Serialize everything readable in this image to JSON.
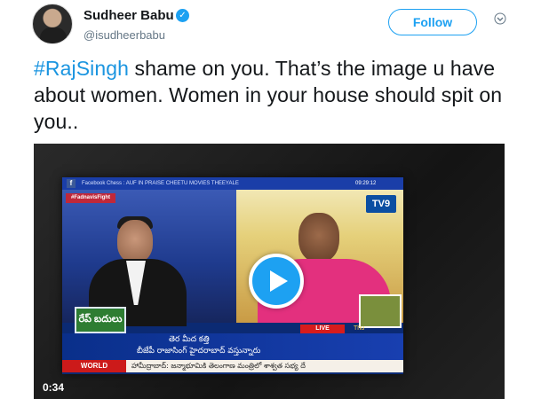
{
  "author": {
    "name": "Sudheer Babu",
    "handle": "@isudheerbabu",
    "verified": true
  },
  "actions": {
    "follow_label": "Follow"
  },
  "tweet": {
    "hashtag": "#RajSingh",
    "text": " shame on you. That’s the image u have about women. Women in your house should spit on you.."
  },
  "video": {
    "duration": "0:34",
    "tv": {
      "tag": "#FadnavisFight",
      "top_ticker": "Facebook Chess : AUF IN PRAISE CHEETU MOVIES THEEYALE",
      "time": "09:29:12",
      "channel": "TV9",
      "show_logo": "రేప్ బదులు",
      "live": "LIVE",
      "day": "Thu",
      "lower_line_1": "తెర మీద కత్తి",
      "lower_line_2": "బీజేపీ రాజాసింగ్ హైదరాబాద్ వస్తున్నారు",
      "world": "WORLD",
      "ticker": "హామీద్రాబాద్: జన్మాభూమికి తెలంగాణ మంత్రిలో శాశ్వత సభ్య దే"
    }
  },
  "colors": {
    "link": "#1b95e0",
    "brand": "#1da1f2"
  }
}
